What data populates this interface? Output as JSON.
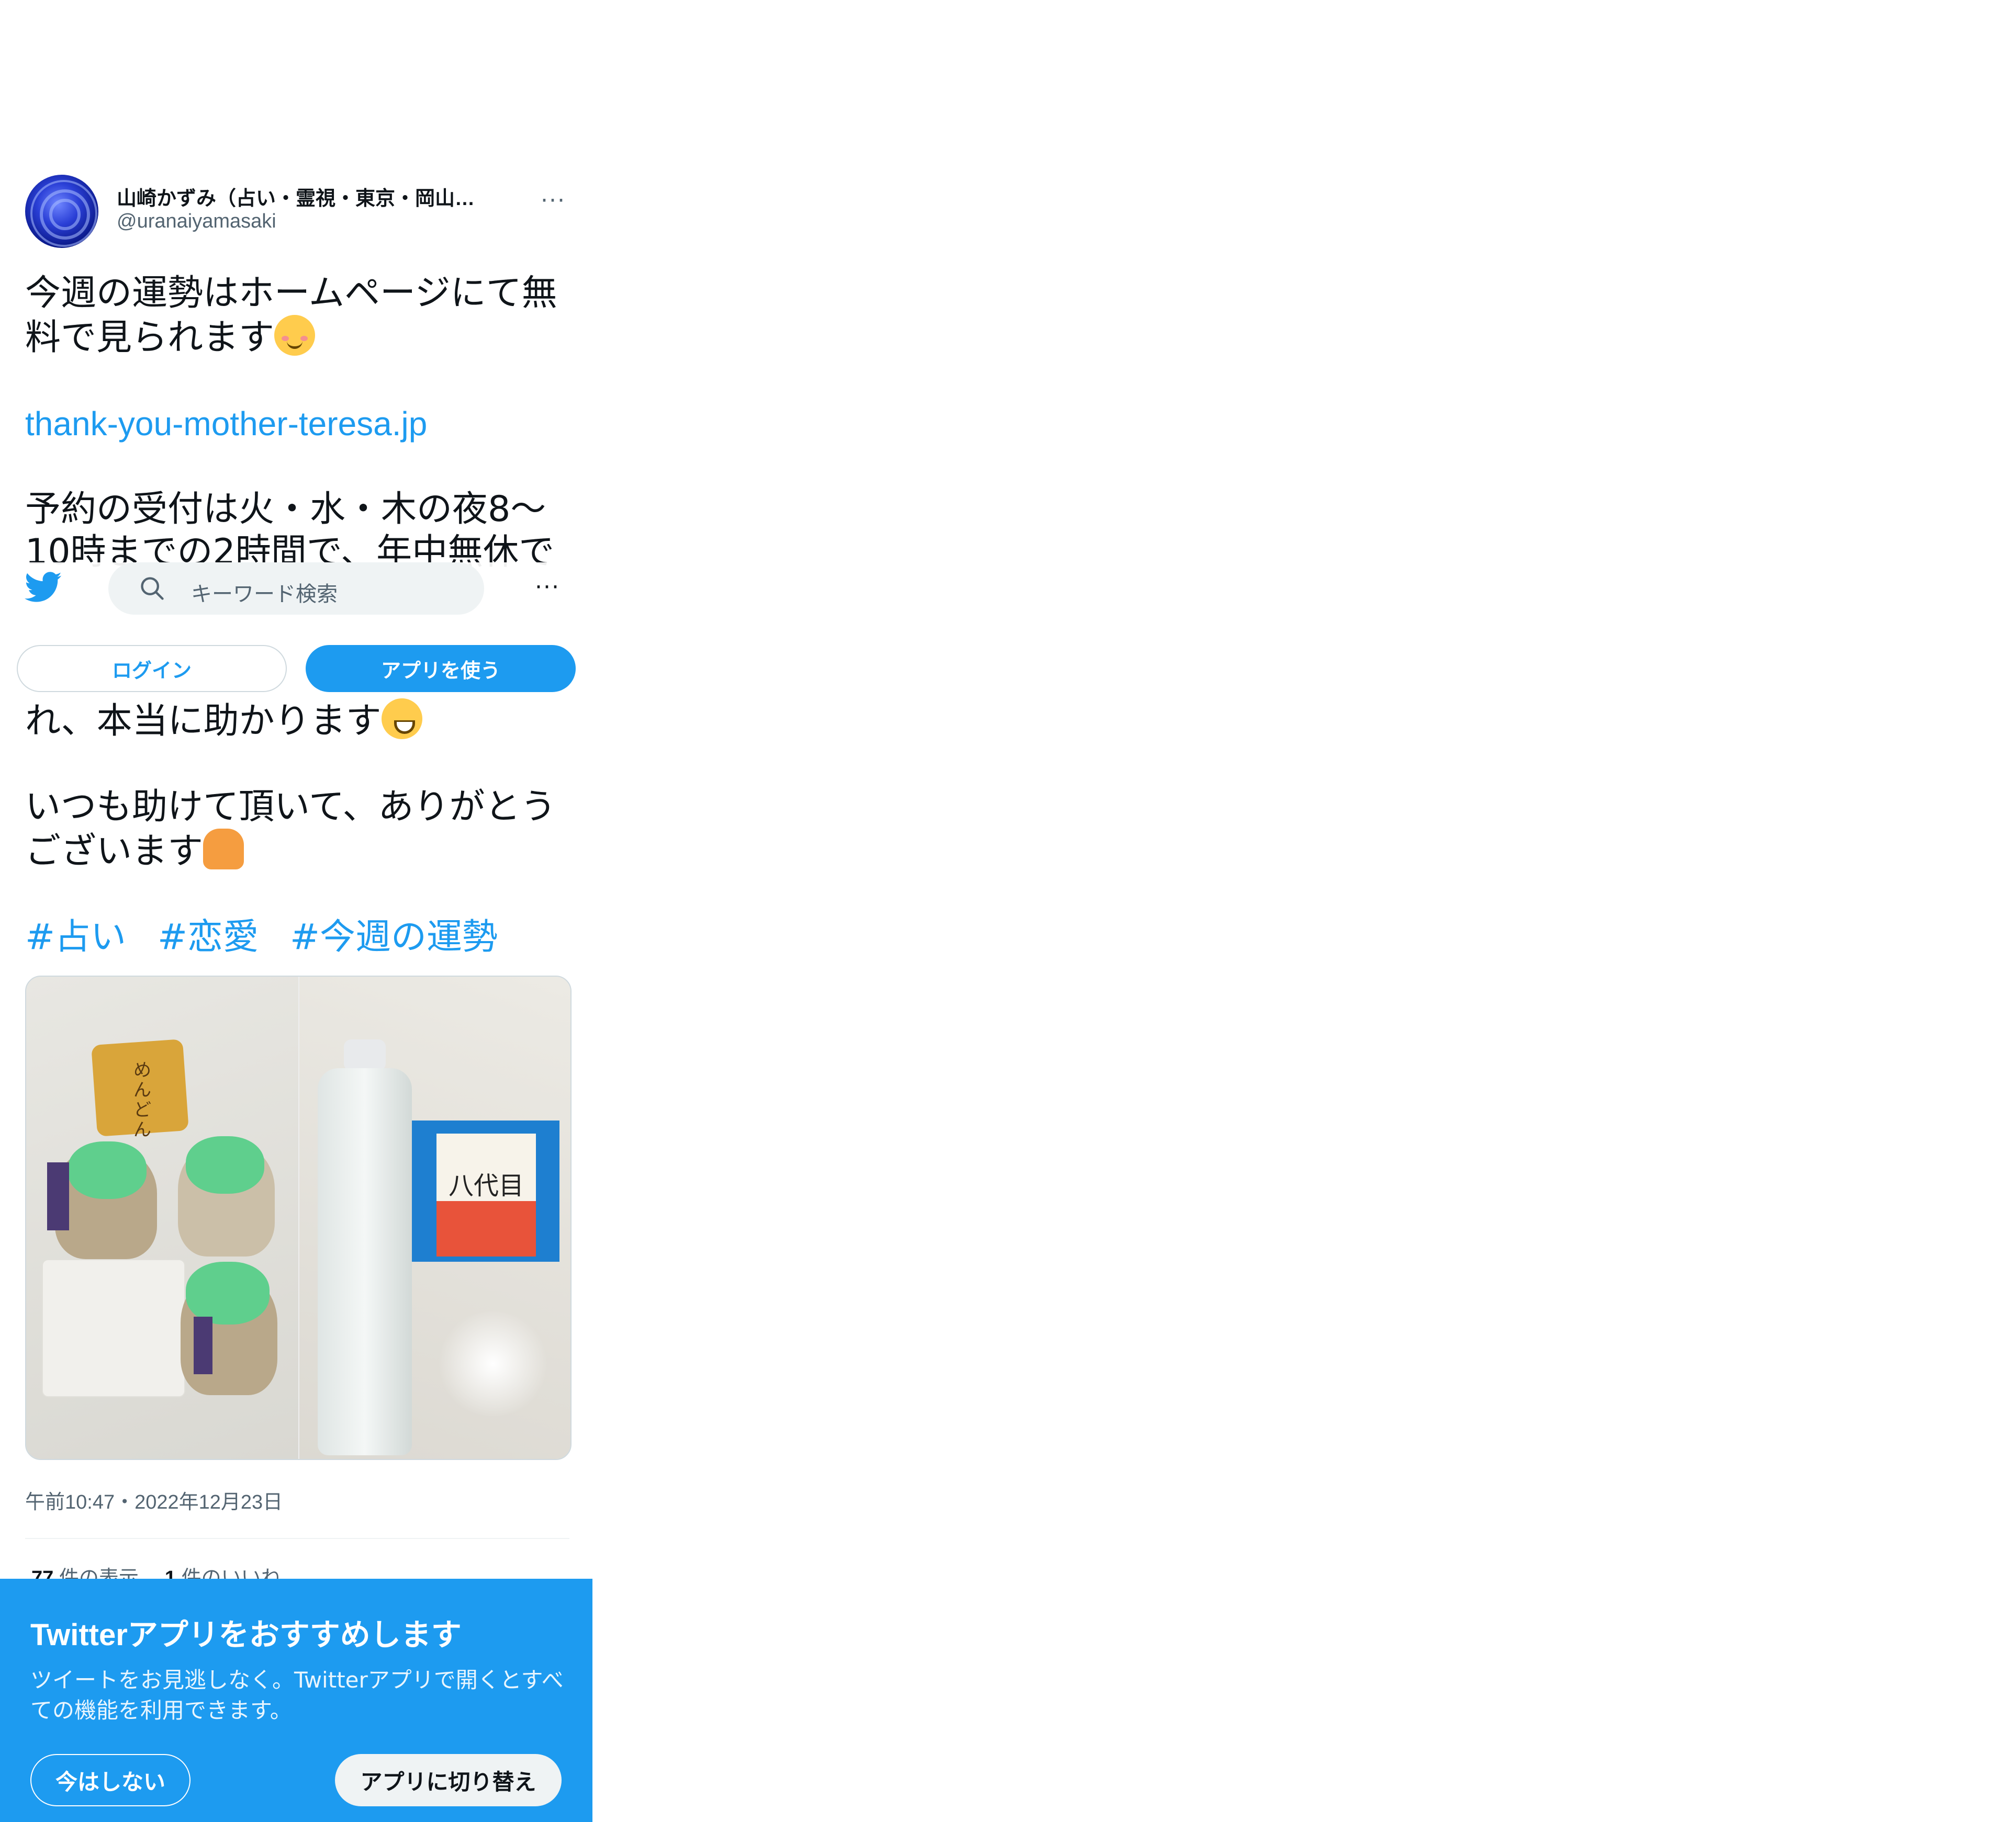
{
  "tweet": {
    "author": {
      "display_name": "山崎かずみ（占い・霊視・東京・岡山…",
      "handle": "@uranaiyamasaki"
    },
    "more_label": "···",
    "text": {
      "p1": "今週の運勢はホームページにて無料で見られます",
      "link": "thank-you-mother-teresa.jp",
      "p3": "予約の受付は火・水・木の夜8〜10時までの2時間で、年中無休で",
      "p4": "れ、本当に助かります",
      "p5": "いつも助けて頂いて、ありがとうございます"
    },
    "hashtags": [
      "#占い",
      "#恋愛",
      "#今週の運勢"
    ],
    "timestamp": "午前10:47・2022年12月23日",
    "stats": {
      "views_count": "77",
      "views_label": "件の表示",
      "likes_count": "1",
      "likes_label": "件のいいね"
    },
    "media": {
      "left_text": "めんどん",
      "right_text": "八代目"
    }
  },
  "topbar": {
    "search_placeholder": "キーワード検索",
    "more_label": "···"
  },
  "auth": {
    "login_label": "ログイン",
    "app_label": "アプリを使う"
  },
  "promo": {
    "title": "Twitterアプリをおすすめします",
    "description": "ツイートをお見逃しなく。Twitterアプリで開くとすべての機能を利用できます。",
    "not_now_label": "今はしない",
    "switch_label": "アプリに切り替え"
  },
  "colors": {
    "accent": "#1d9bf0",
    "text": "#0f1419",
    "secondary": "#536471"
  }
}
